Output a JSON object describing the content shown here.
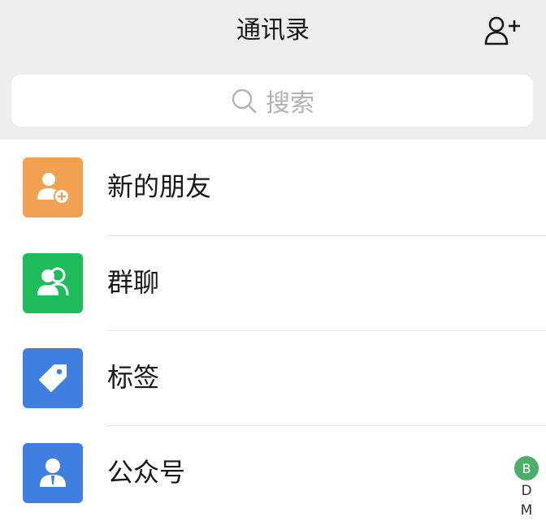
{
  "header": {
    "title": "通讯录",
    "add_icon": "add-contact-icon"
  },
  "search": {
    "placeholder": "搜索",
    "icon": "search-icon"
  },
  "entries": [
    {
      "label": "新的朋友",
      "icon": "new-friend-icon",
      "color": "#f0a151"
    },
    {
      "label": "群聊",
      "icon": "group-chat-icon",
      "color": "#1fbc5a"
    },
    {
      "label": "标签",
      "icon": "tag-icon",
      "color": "#3f7fe0"
    },
    {
      "label": "公众号",
      "icon": "official-account-icon",
      "color": "#3f7fe0"
    }
  ],
  "index_bar": {
    "active": "B",
    "letters": [
      "D",
      "M"
    ]
  },
  "colors": {
    "header_bg": "#ededed",
    "divider": "#e5e5e5",
    "index_active": "#4caf68"
  }
}
